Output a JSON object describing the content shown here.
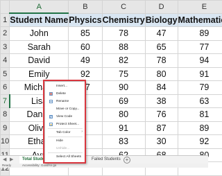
{
  "columns": [
    "A",
    "B",
    "C",
    "D",
    "E"
  ],
  "header_row": [
    "Student Name",
    "Physics",
    "Chemistry",
    "Biology",
    "Mathematics"
  ],
  "rows": [
    [
      "John",
      "85",
      "78",
      "47",
      "89"
    ],
    [
      "Sarah",
      "60",
      "88",
      "65",
      "77"
    ],
    [
      "David",
      "49",
      "82",
      "78",
      "94"
    ],
    [
      "Emily",
      "92",
      "75",
      "80",
      "91"
    ],
    [
      "Michael",
      "67",
      "90",
      "84",
      "79"
    ],
    [
      "Lisa",
      "",
      "69",
      "38",
      "63"
    ],
    [
      "Daniel",
      "",
      "80",
      "76",
      "81"
    ],
    [
      "Olivia",
      "",
      "91",
      "87",
      "89"
    ],
    [
      "Ethan",
      "",
      "83",
      "30",
      "92"
    ],
    [
      "Ava",
      "",
      "62",
      "68",
      "80"
    ]
  ],
  "row_numbers": [
    "1",
    "2",
    "3",
    "4",
    "5",
    "6",
    "7",
    "8",
    "9",
    "10",
    "11",
    "12"
  ],
  "selected_column": "A",
  "selected_row": "7",
  "context_menu": {
    "items": [
      {
        "label": "Insert...",
        "icon": "none"
      },
      {
        "label": "Delete",
        "icon": "delete-sheet-icon"
      },
      {
        "label": "Rename",
        "icon": "rename-icon"
      },
      {
        "label": "Move or Copy...",
        "icon": "none"
      },
      {
        "label": "View Code",
        "icon": "view-code-icon"
      },
      {
        "label": "Protect Sheet...",
        "icon": "protect-sheet-icon"
      },
      {
        "label": "Tab Color",
        "icon": "none",
        "submenu": true
      },
      {
        "label": "Hide",
        "icon": "none"
      },
      {
        "label": "Unhide...",
        "icon": "none",
        "disabled": true
      },
      {
        "label": "Select All Sheets",
        "icon": "none"
      }
    ],
    "submenu_arrow": "›"
  },
  "tabs": {
    "nav_prev": "◀",
    "nav_next": "▶",
    "active": "Total Studen",
    "inactive": "Failed Students",
    "add": "+"
  },
  "status": {
    "ready": "Ready",
    "accessibility": "Accessibility: Good to go"
  },
  "colors": {
    "accent": "#217346",
    "header_fill": "#d9e6f2",
    "highlight_border": "#d9363e"
  }
}
